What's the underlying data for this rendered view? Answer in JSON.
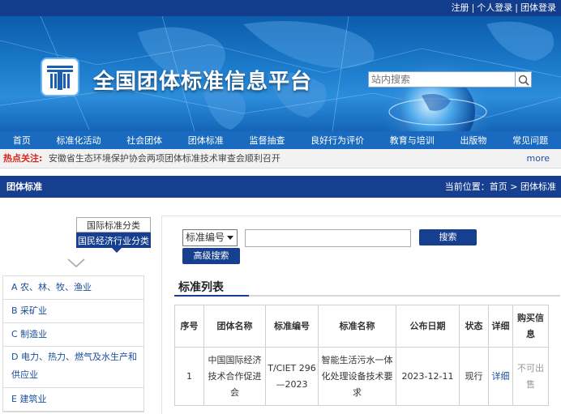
{
  "top_links": [
    "注册",
    "个人登录",
    "团体登录"
  ],
  "site": {
    "title": "全国团体标准信息平台"
  },
  "site_search": {
    "placeholder": "站内搜索"
  },
  "nav": [
    "首页",
    "标准化活动",
    "社会团体",
    "团体标准",
    "监督抽查",
    "良好行为评价",
    "教育与培训",
    "出版物",
    "常见问题"
  ],
  "hot": {
    "label": "热点关注:",
    "text": "安徽省生态环境保护协会两项团体标准技术审查会顺利召开",
    "more": "more"
  },
  "section": {
    "title": "团体标准",
    "location": "当前位置：首页 > 团体标准"
  },
  "category_tabs": {
    "intl": "国际标准分类",
    "national": "国民经济行业分类"
  },
  "categories": [
    "A 农、林、牧、渔业",
    "B 采矿业",
    "C 制造业",
    "D 电力、热力、燃气及水生产和供应业",
    "E 建筑业"
  ],
  "search": {
    "select_value": "标准编号",
    "search_label": "搜索",
    "advanced_label": "高级搜索"
  },
  "list": {
    "title": "标准列表",
    "headers": [
      "序号",
      "团体名称",
      "标准编号",
      "标准名称",
      "公布日期",
      "状态",
      "详细",
      "购买信息"
    ],
    "rows": [
      {
        "index": "1",
        "org": "中国国际经济技术合作促进会",
        "code": "T/CIET 296—2023",
        "name": "智能生活污水一体化处理设备技术要求",
        "date": "2023-12-11",
        "status": "现行",
        "detail": "详细",
        "buy": "不可出售"
      }
    ]
  },
  "colors": {
    "primary": "#173f8f",
    "link": "#1a4e9c",
    "hot": "#d8261a"
  }
}
